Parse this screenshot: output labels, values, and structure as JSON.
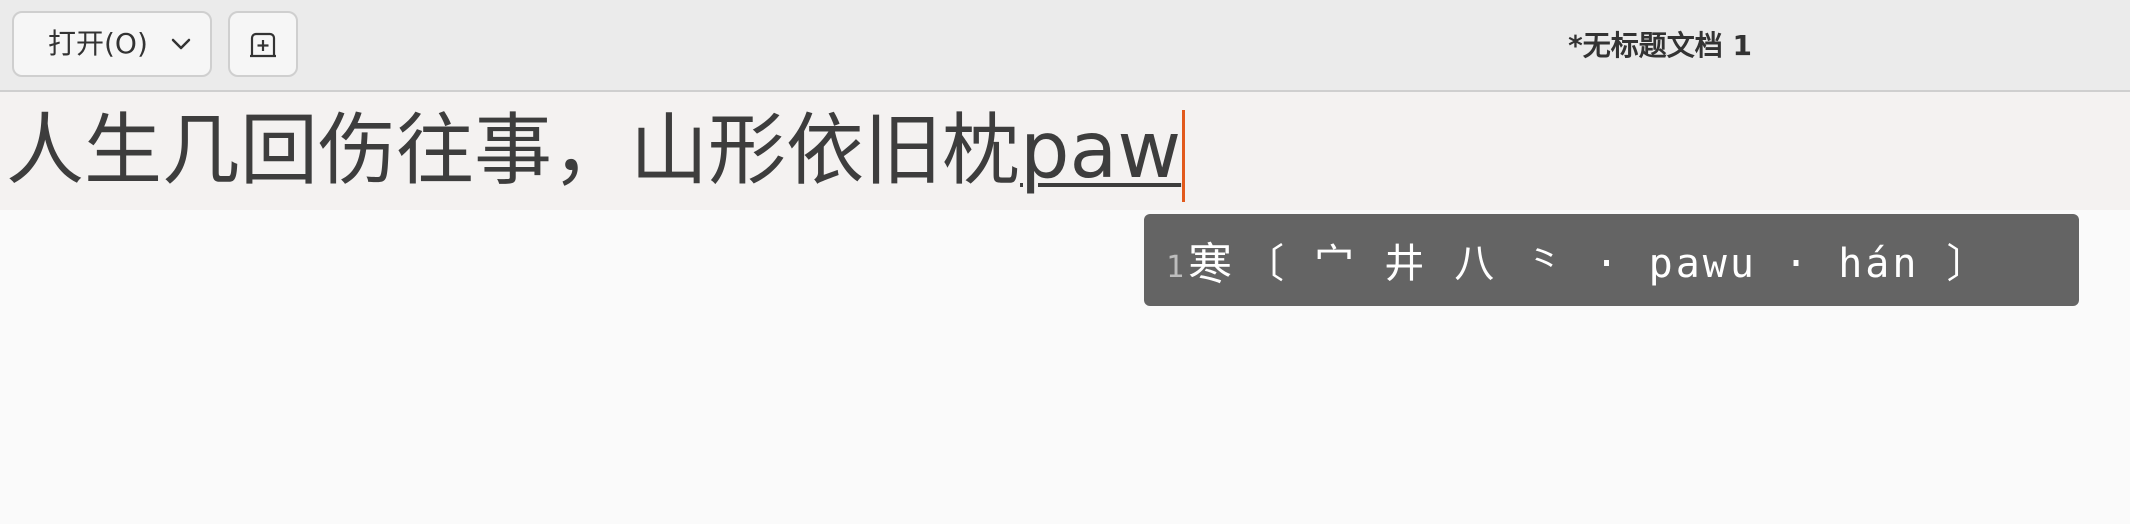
{
  "window": {
    "title": "*无标题文档 1"
  },
  "header": {
    "open_button_label": "打开(O)",
    "open_dropdown_icon": "chevron-down-icon",
    "new_tab_icon": "new-tab-icon"
  },
  "editor": {
    "committed_text": "人生几回伤往事，山形依旧枕",
    "preedit_text": "paw"
  },
  "ime_candidates": {
    "items": [
      {
        "index": "1",
        "text": "寒",
        "comment": "〔 宀 井 八 ⺀ · pawu · hán 〕"
      }
    ]
  },
  "colors": {
    "caret": "#e25a1c",
    "popup_bg": "#646464",
    "header_bg": "#ebebeb"
  }
}
